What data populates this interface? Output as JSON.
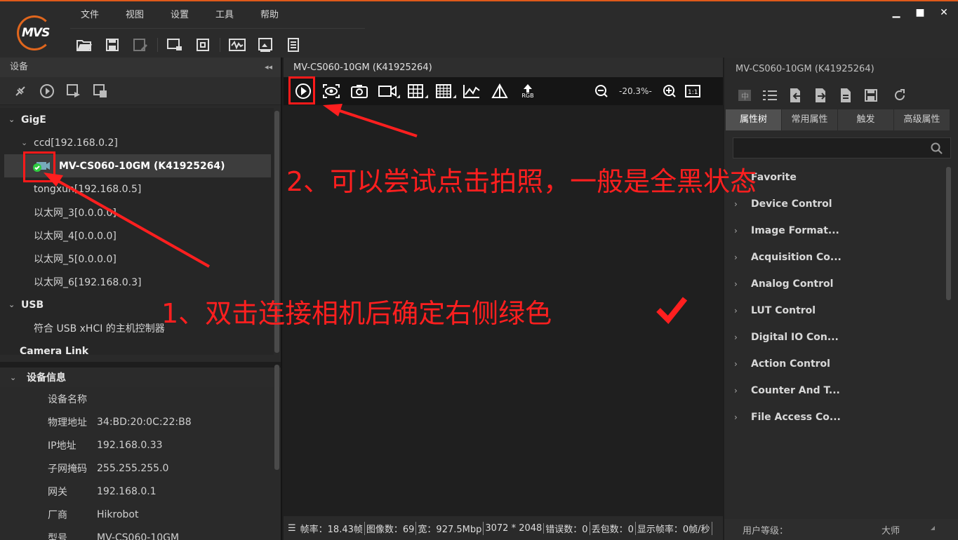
{
  "app": {
    "logo_text": "MVS"
  },
  "menu": [
    "文件",
    "视图",
    "设置",
    "工具",
    "帮助"
  ],
  "window_controls": [
    "minimize-icon",
    "maximize-icon",
    "close-icon"
  ],
  "left_panel": {
    "title": "设备",
    "collapse": "◂◂",
    "tree": {
      "gige_label": "GigE",
      "ccd_label": "ccd[192.168.0.2]",
      "camera_label": "MV-CS060-10GM (K41925264)",
      "leaves": [
        "tongxun[192.168.0.5]",
        "以太网_3[0.0.0.0]",
        "以太网_4[0.0.0.0]",
        "以太网_5[0.0.0.0]",
        "以太网_6[192.168.0.3]"
      ],
      "usb_label": "USB",
      "usb_leaf": "符合 USB xHCI 的主机控制器",
      "cameralink_label": "Camera Link"
    },
    "info_title": "设备信息",
    "info": [
      {
        "k": "设备名称",
        "v": ""
      },
      {
        "k": "物理地址",
        "v": "34:BD:20:0C:22:B8"
      },
      {
        "k": "IP地址",
        "v": "192.168.0.33"
      },
      {
        "k": "子网掩码",
        "v": "255.255.255.0"
      },
      {
        "k": "网关",
        "v": "192.168.0.1"
      },
      {
        "k": "厂商",
        "v": "Hikrobot"
      },
      {
        "k": "型号",
        "v": "MV-CS060-10GM"
      }
    ]
  },
  "center": {
    "title": "MV-CS060-10GM (K41925264)",
    "zoom": "-20.3%-",
    "rgb_label": "RGB",
    "status": [
      "帧率：18.43帧",
      "图像数：69",
      "宽：927.5Mbp",
      "3072 * 2048",
      "错误数：0",
      "丢包数：0",
      "显示帧率：0帧/秒"
    ]
  },
  "right_panel": {
    "title": "MV-CS060-10GM (K41925264)",
    "tabs": [
      "属性树",
      "常用属性",
      "触发",
      "高级属性"
    ],
    "search_placeholder": "",
    "favorite": "Favorite",
    "props": [
      "Device Control",
      "Image Format...",
      "Acquisition Co...",
      "Analog Control",
      "LUT Control",
      "Digital IO Con...",
      "Action Control",
      "Counter And T...",
      "File Access Co..."
    ],
    "user_level_label": "用户等级：",
    "user_level_value": "大师"
  },
  "annotations": {
    "step1": "1、双击连接相机后确定右侧绿色",
    "step2": "2、可以尝试点击拍照，一般是全黑状态"
  },
  "colors": {
    "accent": "#e05a1a",
    "annotation": "#ff1f1f",
    "connected": "#2ecc40"
  }
}
